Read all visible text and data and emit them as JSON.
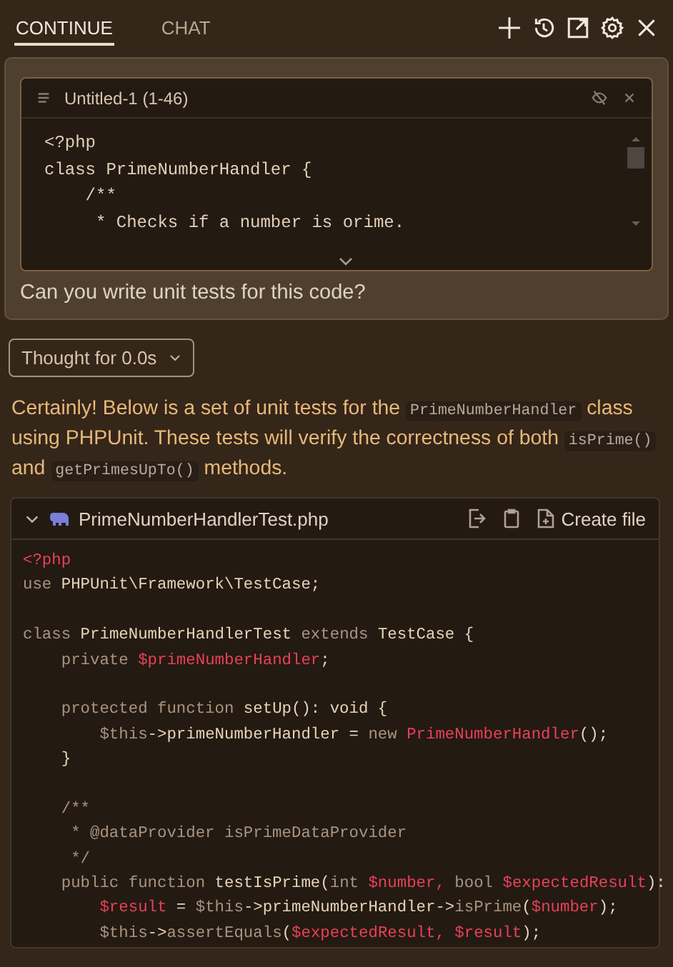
{
  "tabs": [
    {
      "label": "CONTINUE",
      "selected": true
    },
    {
      "label": "CHAT",
      "selected": false
    }
  ],
  "toolbar": [
    {
      "kind": "plus"
    },
    {
      "kind": "history"
    },
    {
      "kind": "external"
    },
    {
      "kind": "gear"
    },
    {
      "kind": "close"
    }
  ],
  "user_message": {
    "attachment": {
      "title": "Untitled-1 (1-46)",
      "lines": [
        "<?php",
        "class PrimeNumberHandler {",
        "    /**",
        "     * Checks if a number is orime."
      ]
    },
    "text": "Can you write unit tests for this code?"
  },
  "thought": {
    "label": "Thought for 0.0s"
  },
  "answer": {
    "paragraph": [
      {
        "kind": "text",
        "text": "Certainly! Below is a set of unit tests for the "
      },
      {
        "kind": "code",
        "text": "PrimeNumberHandler"
      },
      {
        "kind": "text",
        "text": " class using PHPUnit. These tests will verify the correctness of both "
      },
      {
        "kind": "code",
        "text": "isPrime()"
      },
      {
        "kind": "text",
        "text": " and "
      },
      {
        "kind": "code",
        "text": "getPrimesUpTo()"
      },
      {
        "kind": "text",
        "text": " methods."
      }
    ],
    "code_block": {
      "filename": "PrimeNumberHandlerTest.php",
      "create_label": "Create file",
      "lines": [
        {
          "kind": "code",
          "tokens": [
            {
              "kind": "red",
              "text": "<?php"
            }
          ]
        },
        {
          "kind": "code",
          "tokens": [
            {
              "kind": "kw",
              "text": "use "
            },
            {
              "kind": "plain",
              "text": "PHPUnit\\Framework\\TestCase;"
            }
          ]
        },
        {
          "kind": "blank"
        },
        {
          "kind": "code",
          "tokens": [
            {
              "kind": "kw",
              "text": "class "
            },
            {
              "kind": "plain",
              "text": "PrimeNumberHandlerTest "
            },
            {
              "kind": "kw",
              "text": "extends "
            },
            {
              "kind": "plain",
              "text": "TestCase {"
            }
          ]
        },
        {
          "kind": "code",
          "tokens": [
            {
              "kind": "kw",
              "text": "    private "
            },
            {
              "kind": "red",
              "text": "$primeNumberHandler"
            },
            {
              "kind": "plain",
              "text": ";"
            }
          ]
        },
        {
          "kind": "blank"
        },
        {
          "kind": "code",
          "tokens": [
            {
              "kind": "kw",
              "text": "    protected function "
            },
            {
              "kind": "plain",
              "text": "setUp(): void {"
            }
          ]
        },
        {
          "kind": "code",
          "tokens": [
            {
              "kind": "kw",
              "text": "        $this"
            },
            {
              "kind": "plain",
              "text": "->primeNumberHandler = "
            },
            {
              "kind": "kw",
              "text": "new "
            },
            {
              "kind": "red",
              "text": "PrimeNumberHandler"
            },
            {
              "kind": "plain",
              "text": "();"
            }
          ]
        },
        {
          "kind": "code",
          "tokens": [
            {
              "kind": "plain",
              "text": "    }"
            }
          ]
        },
        {
          "kind": "blank"
        },
        {
          "kind": "code",
          "tokens": [
            {
              "kind": "kw",
              "text": "    /**"
            }
          ]
        },
        {
          "kind": "code",
          "tokens": [
            {
              "kind": "kw",
              "text": "     * @dataProvider isPrimeDataProvider"
            }
          ]
        },
        {
          "kind": "code",
          "tokens": [
            {
              "kind": "kw",
              "text": "     */"
            }
          ]
        },
        {
          "kind": "code",
          "tokens": [
            {
              "kind": "kw",
              "text": "    public function "
            },
            {
              "kind": "plain",
              "text": "testIsPrime("
            },
            {
              "kind": "kw",
              "text": "int "
            },
            {
              "kind": "red",
              "text": "$number, "
            },
            {
              "kind": "kw",
              "text": "bool "
            },
            {
              "kind": "red",
              "text": "$expectedResult"
            },
            {
              "kind": "plain",
              "text": "):"
            }
          ]
        },
        {
          "kind": "code",
          "tokens": [
            {
              "kind": "red",
              "text": "        $result "
            },
            {
              "kind": "plain",
              "text": "= "
            },
            {
              "kind": "kw",
              "text": "$this"
            },
            {
              "kind": "plain",
              "text": "->primeNumberHandler->"
            },
            {
              "kind": "kw",
              "text": "isPrime"
            },
            {
              "kind": "plain",
              "text": "("
            },
            {
              "kind": "red",
              "text": "$number"
            },
            {
              "kind": "plain",
              "text": ");"
            }
          ]
        },
        {
          "kind": "code",
          "tokens": [
            {
              "kind": "kw",
              "text": "        $this"
            },
            {
              "kind": "plain",
              "text": "->"
            },
            {
              "kind": "kw",
              "text": "assertEquals"
            },
            {
              "kind": "plain",
              "text": "("
            },
            {
              "kind": "red",
              "text": "$expectedResult, $result"
            },
            {
              "kind": "plain",
              "text": ");"
            }
          ]
        }
      ]
    }
  }
}
